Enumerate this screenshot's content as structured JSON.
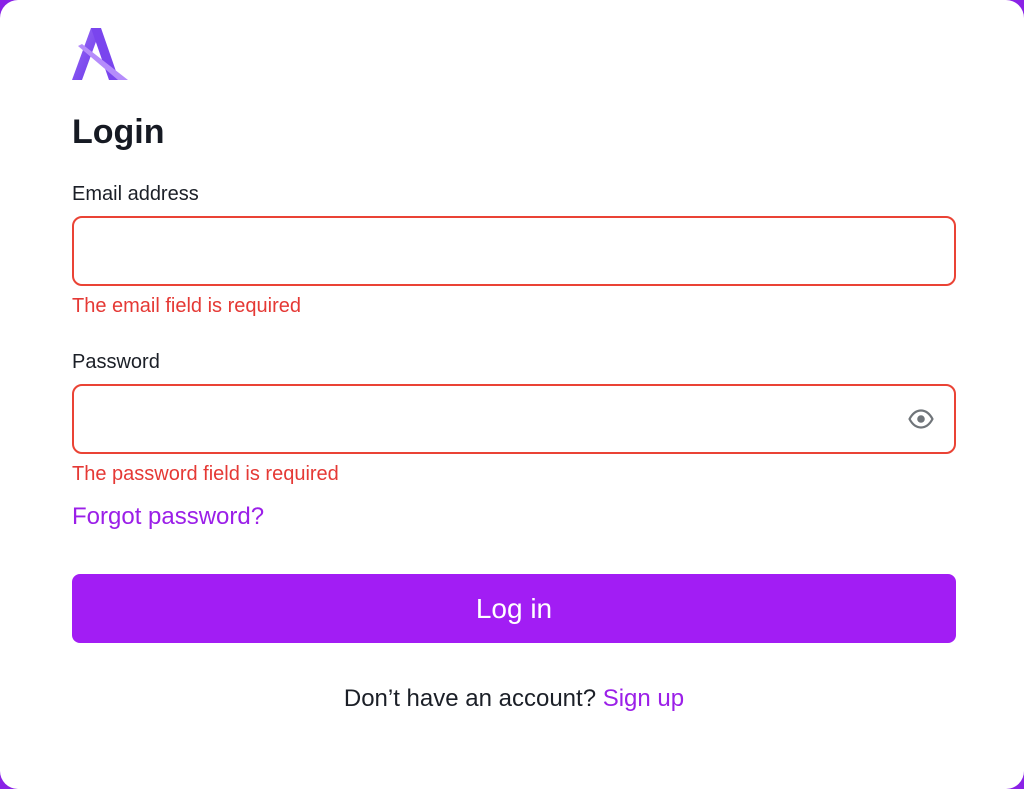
{
  "logo": {
    "icon": "brand-a-logo-icon",
    "colors": [
      "#8e5cf5",
      "#6a35e8"
    ]
  },
  "title": "Login",
  "email": {
    "label": "Email address",
    "value": "",
    "placeholder": "",
    "error": "The email field is required"
  },
  "password": {
    "label": "Password",
    "value": "",
    "placeholder": "",
    "error": "The password field is required",
    "toggle_icon": "eye-icon"
  },
  "forgot_password": "Forgot password?",
  "login_button": "Log in",
  "signup": {
    "prompt": "Don’t have an account?",
    "link": "Sign up"
  },
  "colors": {
    "brand": "#a21df4",
    "link": "#9b1fe8",
    "error": "#ea4335",
    "text": "#161a23"
  }
}
